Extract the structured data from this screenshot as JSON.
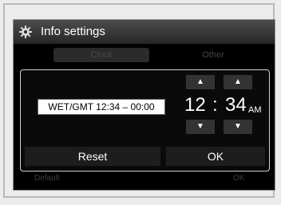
{
  "window": {
    "title": "Info settings"
  },
  "tabs": [
    {
      "label": "Clock"
    },
    {
      "label": "Other"
    }
  ],
  "dialog": {
    "timezone": "WET/GMT 12:34 – 00:00",
    "hour": "12",
    "separator": ":",
    "minute": "34",
    "ampm": "AM",
    "up_glyph": "▲",
    "down_glyph": "▼",
    "reset_label": "Reset",
    "ok_label": "OK"
  },
  "background_buttons": {
    "default_label": "Default",
    "ok_label": "OK"
  }
}
